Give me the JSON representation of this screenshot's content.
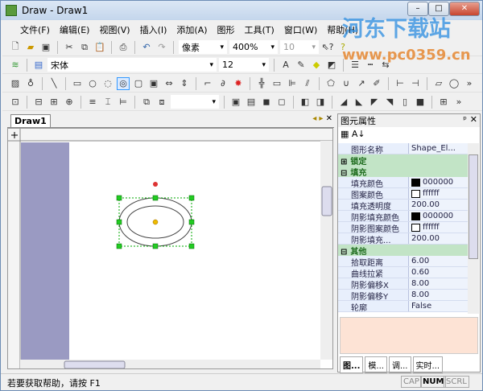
{
  "window": {
    "title": "Draw - Draw1",
    "minimize": "–",
    "maximize": "□",
    "close": "✕"
  },
  "menu": [
    "文件(F)",
    "编辑(E)",
    "视图(V)",
    "插入(I)",
    "添加(A)",
    "图形",
    "工具(T)",
    "窗口(W)",
    "帮助(H)"
  ],
  "toolbar1": {
    "unit": "像素",
    "zoom": "400%",
    "size": "10"
  },
  "toolbar2": {
    "font": "宋体",
    "font_size": "12"
  },
  "document": {
    "tab": "Draw1"
  },
  "panel": {
    "title": "图元属性",
    "pin": "ᵖ",
    "close": "✕",
    "rows_top": [
      {
        "k": "图形名称",
        "v": "Shape_El..."
      }
    ],
    "groups": [
      {
        "name": "锁定",
        "sign": "⊞",
        "rows": []
      },
      {
        "name": "填充",
        "sign": "⊟",
        "rows": [
          {
            "k": "填充颜色",
            "v": "000000",
            "swatch": "#000000"
          },
          {
            "k": "图案颜色",
            "v": "ffffff",
            "swatch": "#ffffff"
          },
          {
            "k": "填充透明度",
            "v": "200.00"
          },
          {
            "k": "阴影填充颜色",
            "v": "000000",
            "swatch": "#000000"
          },
          {
            "k": "阴影图案颜色",
            "v": "ffffff",
            "swatch": "#ffffff"
          },
          {
            "k": "阴影填充...",
            "v": "200.00"
          }
        ]
      },
      {
        "name": "其他",
        "sign": "⊟",
        "rows": [
          {
            "k": "拾取距离",
            "v": "6.00"
          },
          {
            "k": "曲线拉紧",
            "v": "0.60"
          },
          {
            "k": "阴影偏移X",
            "v": "8.00"
          },
          {
            "k": "阴影偏移Y",
            "v": "8.00"
          },
          {
            "k": "轮廓",
            "v": "False"
          }
        ]
      }
    ],
    "tabs": [
      "图...",
      "模...",
      "调...",
      "实时..."
    ]
  },
  "status": {
    "text": "若要获取帮助，请按 F1",
    "cap": "CAP",
    "num": "NUM",
    "scrl": "SCRL"
  },
  "watermark": {
    "name": "河东下载站",
    "url": "www.pc0359.cn"
  },
  "colors": {
    "group_bg": "#c2e4c6",
    "desc_bg": "#fde3d5",
    "page_margin": "#9a9ac2"
  }
}
